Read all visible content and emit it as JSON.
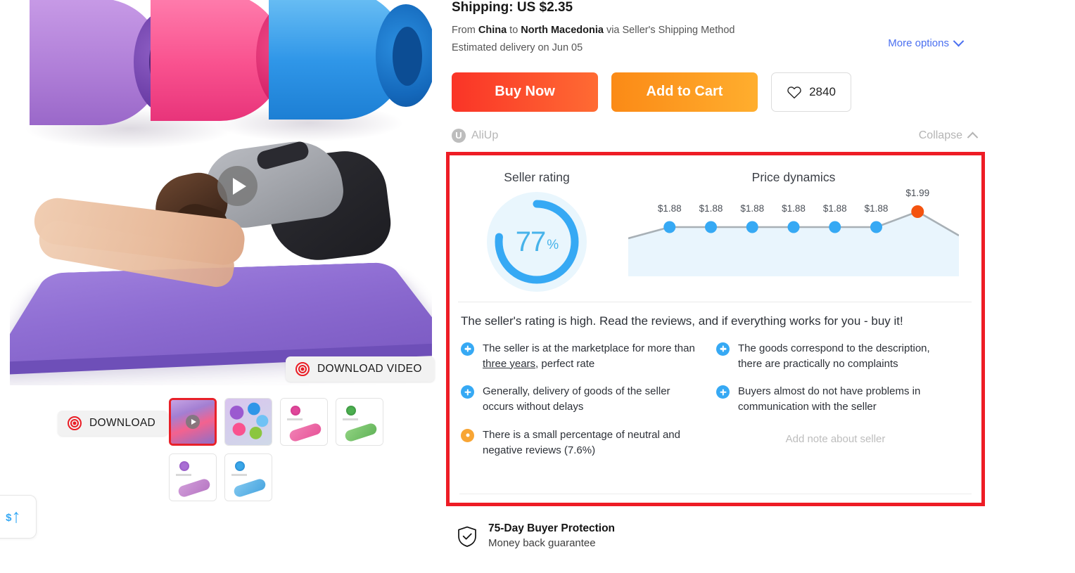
{
  "shipping": {
    "title": "Shipping: US $2.35",
    "route_prefix": "From ",
    "origin": "China",
    "route_mid": " to ",
    "destination": "North Macedonia",
    "route_suffix": " via Seller's Shipping Method",
    "delivery": "Estimated delivery on Jun 05",
    "more_options_label": "More options"
  },
  "actions": {
    "buy_now_label": "Buy Now",
    "add_to_cart_label": "Add to Cart",
    "wishlist_count": "2840",
    "buy_now_color": "#fa3427",
    "add_to_cart_color": "#fb8a16"
  },
  "extension_bar": {
    "brand": "AliUp",
    "brand_initial": "U",
    "collapse_label": "Collapse"
  },
  "seller_widget": {
    "rating_heading": "Seller rating",
    "rating_value": "77",
    "rating_unit": "%",
    "rating_percent": 77,
    "accent_color": "#36a9f4",
    "price_heading": "Price dynamics",
    "summary": "The seller's rating is high. Read the reviews, and if everything works for you - buy it!",
    "facts_left": [
      {
        "type": "plus",
        "text_before": "The seller is at the marketplace for more than ",
        "underlined": "three years",
        "text_after": ", perfect rate"
      },
      {
        "type": "plus",
        "text_before": "Generally, delivery of goods of the seller occurs without delays",
        "underlined": "",
        "text_after": ""
      },
      {
        "type": "neutral",
        "text_before": "There is a small percentage of neutral and negative reviews (7.6%)",
        "underlined": "",
        "text_after": ""
      }
    ],
    "facts_right": [
      {
        "type": "plus",
        "text_before": "The goods correspond to the description, there are practically no complaints",
        "underlined": "",
        "text_after": ""
      },
      {
        "type": "plus",
        "text_before": "Buyers almost do not have problems in communication with the seller",
        "underlined": "",
        "text_after": ""
      }
    ],
    "add_note_label": "Add note about seller"
  },
  "chart_data": {
    "type": "line",
    "title": "Price dynamics",
    "xlabel": "",
    "ylabel": "",
    "categories": [
      "1",
      "2",
      "3",
      "4",
      "5",
      "6",
      "7",
      "8",
      "9"
    ],
    "values": [
      1.8,
      1.88,
      1.88,
      1.88,
      1.88,
      1.88,
      1.88,
      1.99,
      1.82
    ],
    "point_labels": [
      "",
      "$1.88",
      "$1.88",
      "$1.88",
      "$1.88",
      "$1.88",
      "$1.88",
      "$1.99",
      ""
    ],
    "marker_colors": [
      "none",
      "#36a9f4",
      "#36a9f4",
      "#36a9f4",
      "#36a9f4",
      "#36a9f4",
      "#36a9f4",
      "#f4530f",
      "none"
    ],
    "highlight_index": 7,
    "highlight_color": "#f4530f",
    "line_color": "#a8b0b6",
    "fill_color": "#e9f5fd",
    "ylim": [
      1.7,
      2.05
    ],
    "grid": false,
    "legend": "none"
  },
  "gallery": {
    "download_video_label": "DOWNLOAD VIDEO",
    "download_label": "DOWNLOAD",
    "thumbnails_row1": [
      {
        "name": "video-thumbnail",
        "selected": true,
        "has_play": true
      },
      {
        "name": "mats-pile-thumbnail",
        "selected": false,
        "has_play": false
      },
      {
        "name": "pink-mat-thumbnail",
        "selected": false,
        "has_play": false
      },
      {
        "name": "green-mat-thumbnail",
        "selected": false,
        "has_play": false
      }
    ],
    "thumbnails_row2": [
      {
        "name": "purple-mat-thumbnail",
        "selected": false,
        "has_play": false
      },
      {
        "name": "blue-mat-thumbnail",
        "selected": false,
        "has_play": false
      }
    ]
  },
  "buyer_protection": {
    "title": "75-Day Buyer Protection",
    "subtitle": "Money back guarantee"
  },
  "price_tracker": {
    "dollar": "$",
    "arrow": "↑"
  }
}
